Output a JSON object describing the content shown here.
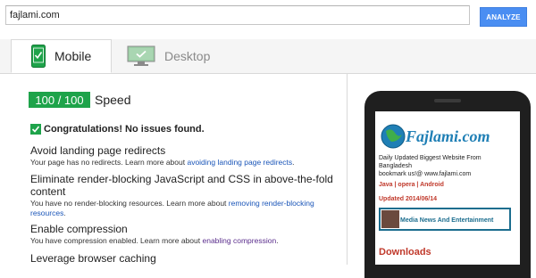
{
  "search": {
    "url_value": "fajlami.com",
    "analyze_label": "ANALYZE"
  },
  "tabs": [
    {
      "label": "Mobile",
      "icon": "mobile-phone-icon",
      "active": true
    },
    {
      "label": "Desktop",
      "icon": "desktop-monitor-icon",
      "active": false
    }
  ],
  "score": {
    "value": "100 / 100",
    "label": "Speed",
    "color": "#1ea34a"
  },
  "congrats": "Congratulations! No issues found.",
  "rules": [
    {
      "title": "Avoid landing page redirects",
      "desc": "Your page has no redirects. Learn more about ",
      "link": "avoiding landing page redirects",
      "after": "."
    },
    {
      "title": "Eliminate render-blocking JavaScript and CSS in above-the-fold content",
      "desc": "You have no render-blocking resources. Learn more about ",
      "link": "removing render-blocking resources",
      "after": "."
    },
    {
      "title": "Enable compression",
      "desc": "You have compression enabled. Learn more about ",
      "link": "enabling compression",
      "after": "."
    },
    {
      "title": "Leverage browser caching"
    }
  ],
  "preview": {
    "logo_text": "Fajlami.com",
    "tagline_1": "Daily Updated Biggest Website From Bangladesh",
    "tagline_2": "bookmark us!@ www.fajlami.com",
    "nav": "Java | opera | Android",
    "updated": "Updated 2014/06/14",
    "media": "Media News And Entertainment",
    "downloads": "Downloads"
  },
  "colors": {
    "accent": "#4a8ef2",
    "link": "#1a55b8",
    "success": "#1ea34a",
    "preview_red": "#c0392b"
  }
}
